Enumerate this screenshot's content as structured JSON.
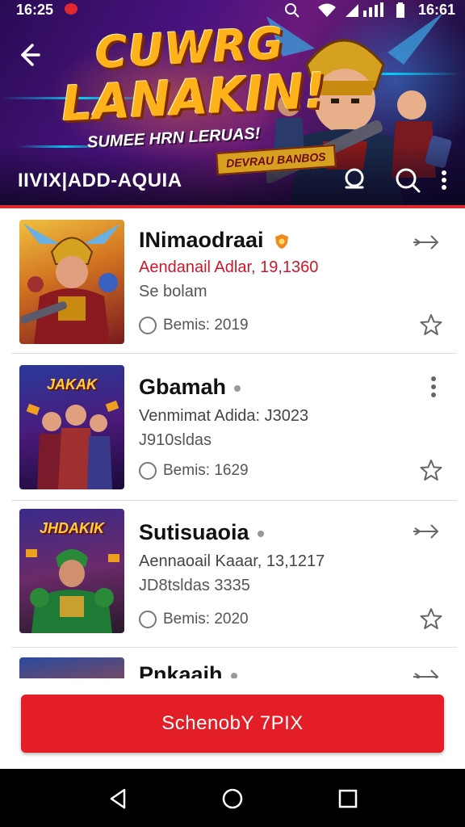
{
  "status_bar": {
    "time_left": "16:25",
    "time_right": "16:61"
  },
  "banner": {
    "title_line1": "CUWRG",
    "title_line2": "LANAKIN!",
    "subtitle": "SUMEE HRN LERUAS!",
    "ribbon": "DEVRAU BANBOS",
    "app_name": "IIVIX|ADD-AQUIA"
  },
  "items": [
    {
      "name": "INimaodraai",
      "line1": "Aendanail Adlar, 19,1360",
      "line2": "Se bolam",
      "meta": "Bemis: 2019",
      "has_shield": true,
      "action": "share"
    },
    {
      "name": "Gbamah",
      "line1": "Venmimat Adida: J3023",
      "line2": "J910sldas",
      "meta": "Bemis: 1629",
      "has_shield": false,
      "action": "more"
    },
    {
      "name": "Sutisuaoia",
      "line1": "Aennaoail Kaaar, 13,1217",
      "line2": "JD8tsldas 3335",
      "meta": "Bemis: 2020",
      "has_shield": false,
      "action": "share"
    },
    {
      "name": "Pnkaaih",
      "line1": "",
      "line2": "",
      "meta": "",
      "has_shield": false,
      "action": "share"
    }
  ],
  "thumb_labels": [
    "",
    "JAKAK",
    "JHDAKIK",
    ""
  ],
  "cta": {
    "label": "SchenobY 7PIX"
  },
  "colors": {
    "accent": "#e31e26",
    "banner_bg": "#4a1380",
    "title_gold": "#ffb21a"
  }
}
